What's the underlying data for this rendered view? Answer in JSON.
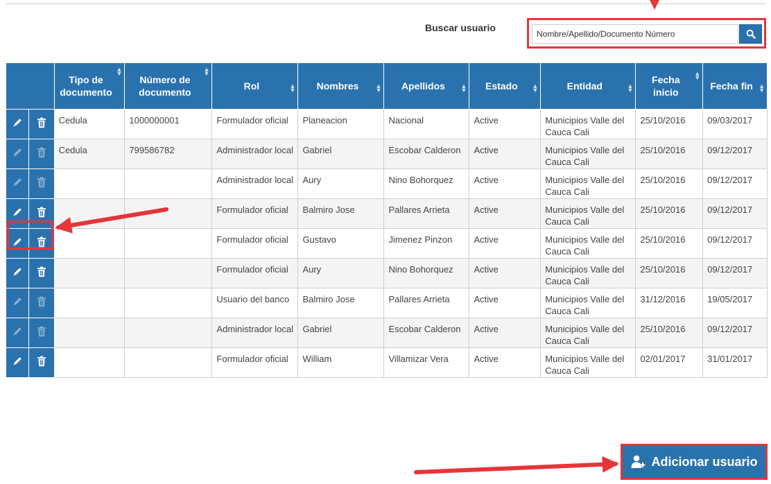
{
  "search": {
    "label": "Buscar usuario",
    "placeholder": "Nombre/Apellido/Documento Número",
    "button_icon": "search-icon"
  },
  "table": {
    "columns": [
      "",
      "Tipo de documento",
      "Número de documento",
      "Rol",
      "Nombres",
      "Apellidos",
      "Estado",
      "Entidad",
      "Fecha inicio",
      "Fecha fin"
    ],
    "rows": [
      {
        "tipo": "Cedula",
        "numero": "1000000001",
        "rol": "Formulador oficial",
        "nombres": "Planeacion",
        "apellidos": "Nacional",
        "estado": "Active",
        "entidad": "Municipios Valle del Cauca Cali",
        "inicio": "25/10/2016",
        "fin": "09/03/2017"
      },
      {
        "tipo": "Cedula",
        "numero": "799586782",
        "rol": "Administrador local",
        "nombres": "Gabriel",
        "apellidos": "Escobar Calderon",
        "estado": "Active",
        "entidad": "Municipios Valle del Cauca Cali",
        "inicio": "25/10/2016",
        "fin": "09/12/2017"
      },
      {
        "tipo": "",
        "numero": "",
        "rol": "Administrador local",
        "nombres": "Aury",
        "apellidos": "Nino Bohorquez",
        "estado": "Active",
        "entidad": "Municipios Valle del Cauca Cali",
        "inicio": "25/10/2016",
        "fin": "09/12/2017"
      },
      {
        "tipo": "",
        "numero": "",
        "rol": "Formulador oficial",
        "nombres": "Balmiro Jose",
        "apellidos": "Pallares Arrieta",
        "estado": "Active",
        "entidad": "Municipios Valle del Cauca Cali",
        "inicio": "25/10/2016",
        "fin": "09/12/2017"
      },
      {
        "tipo": "",
        "numero": "",
        "rol": "Formulador oficial",
        "nombres": "Gustavo",
        "apellidos": "Jimenez Pinzon",
        "estado": "Active",
        "entidad": "Municipios Valle del Cauca Cali",
        "inicio": "25/10/2016",
        "fin": "09/12/2017"
      },
      {
        "tipo": "",
        "numero": "",
        "rol": "Formulador oficial",
        "nombres": "Aury",
        "apellidos": "Nino Bohorquez",
        "estado": "Active",
        "entidad": "Municipios Valle del Cauca Cali",
        "inicio": "25/10/2016",
        "fin": "09/12/2017"
      },
      {
        "tipo": "",
        "numero": "",
        "rol": "Usuario del banco",
        "nombres": "Balmiro Jose",
        "apellidos": "Pallares Arrieta",
        "estado": "Active",
        "entidad": "Municipios Valle del Cauca Cali",
        "inicio": "31/12/2016",
        "fin": "19/05/2017"
      },
      {
        "tipo": "",
        "numero": "",
        "rol": "Administrador local",
        "nombres": "Gabriel",
        "apellidos": "Escobar Calderon",
        "estado": "Active",
        "entidad": "Municipios Valle del Cauca Cali",
        "inicio": "25/10/2016",
        "fin": "09/12/2017"
      },
      {
        "tipo": "",
        "numero": "",
        "rol": "Formulador oficial",
        "nombres": "William",
        "apellidos": "Villamizar Vera",
        "estado": "Active",
        "entidad": "Municipios Valle del Cauca Cali",
        "inicio": "02/01/2017",
        "fin": "31/01/2017"
      }
    ],
    "row_actions": [
      "edit-icon",
      "trash-icon"
    ]
  },
  "add_button": {
    "label": "Adicionar usuario",
    "icon": "add-user-icon"
  },
  "colors": {
    "primary": "#2a72ad",
    "highlight": "#e5353a"
  }
}
